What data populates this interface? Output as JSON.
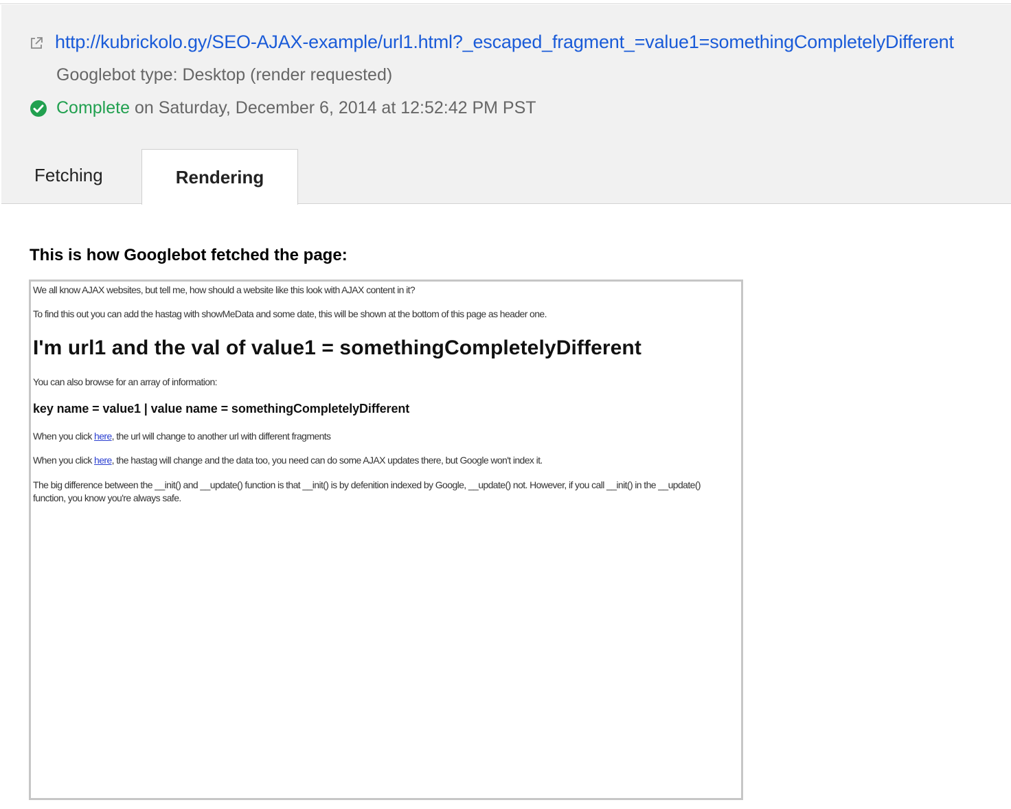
{
  "header": {
    "url": "http://kubrickolo.gy/SEO-AJAX-example/url1.html?_escaped_fragment_=value1=somethingCompletelyDifferent",
    "googlebot_type": "Googlebot type: Desktop (render requested)",
    "status_label": "Complete",
    "status_detail": " on Saturday, December 6, 2014 at 12:52:42 PM PST",
    "external_link_icon": "external-link-icon",
    "status_icon": "check-circle-icon"
  },
  "tabs": [
    {
      "label": "Fetching",
      "active": false
    },
    {
      "label": "Rendering",
      "active": true
    }
  ],
  "main": {
    "heading": "This is how Googlebot fetched the page:"
  },
  "preview": {
    "line1": "We all know AJAX websites, but tell me, how should a website like this look with AJAX content in it?",
    "line2": "To find this out you can add the hastag with showMeData and some date, this will be shown at the bottom of this page as header one.",
    "heading1": "I'm url1 and the val of value1 = somethingCompletelyDifferent",
    "line3": "You can also browse for an array of information:",
    "heading3": "key name = value1 | value name = somethingCompletelyDifferent",
    "line4_before": "When you click ",
    "line4_link": "here",
    "line4_after": ", the url will change to another url with different fragments",
    "line5_before": "When you click ",
    "line5_link": "here",
    "line5_after": ", the hastag will change and the data too, you need can do some AJAX updates there, but Google won't index it.",
    "line6": "The big difference between the __init() and __update() function is that __init() is by defenition indexed by Google, __update() not. However, if you call __init() in the __update() function, you know you're always safe."
  },
  "colors": {
    "link_blue": "#1a5bd8",
    "status_green": "#21a04f",
    "panel_gray": "#f1f1f1"
  }
}
